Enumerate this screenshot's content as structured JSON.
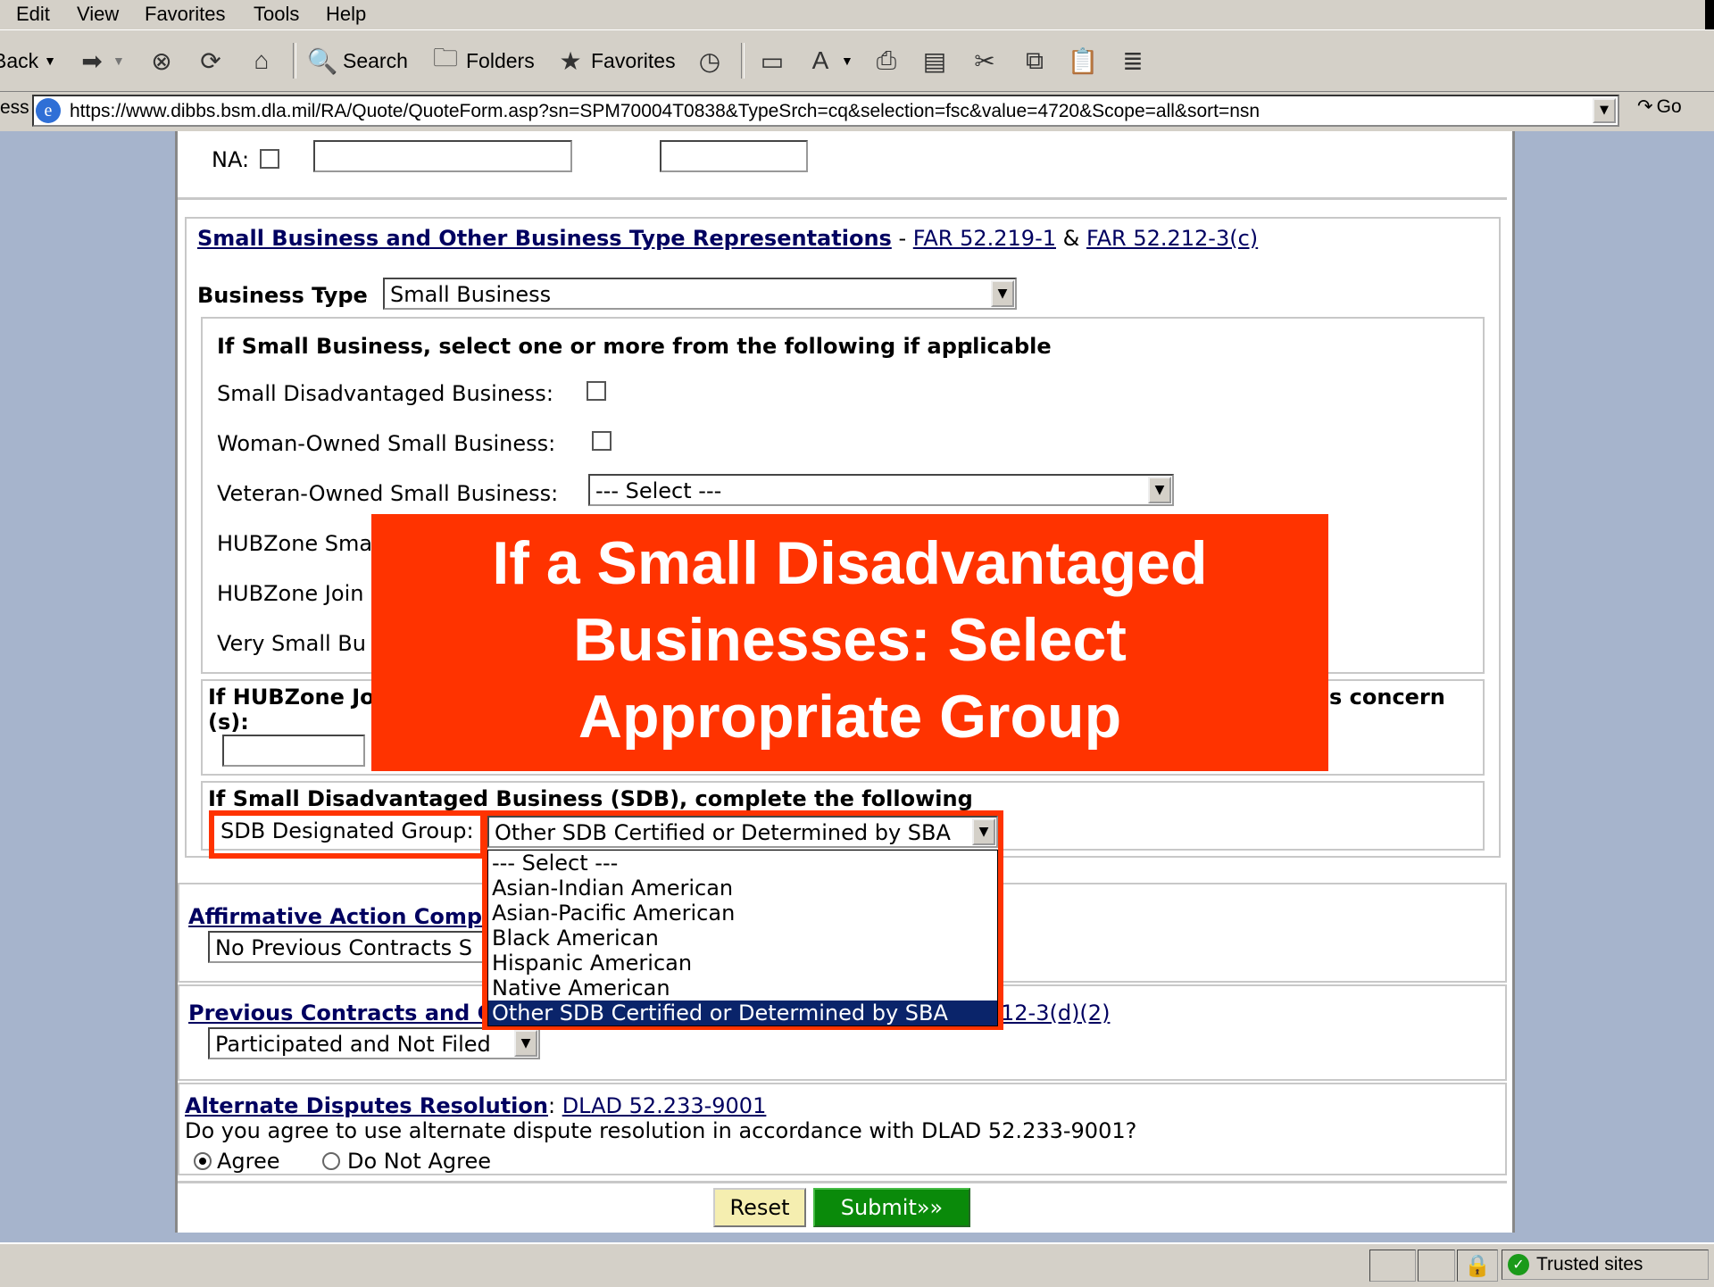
{
  "menu": [
    "Edit",
    "View",
    "Favorites",
    "Tools",
    "Help"
  ],
  "toolbar": {
    "back": "Back",
    "search": "Search",
    "folders": "Folders",
    "favorites": "Favorites"
  },
  "address": {
    "label": "ess",
    "url": "https://www.dibbs.bsm.dla.mil/RA/Quote/QuoteForm.asp?sn=SPM70004T0838&TypeSrch=cq&selection=fsc&value=4720&Scope=all&sort=nsn",
    "go": "Go"
  },
  "form": {
    "na_label": "NA:",
    "small_business_heading": "Small Business and Other Business Type Representations",
    "far_sep1": "-",
    "far_link1": "FAR 52.219-1",
    "far_sep2": "&",
    "far_link2": "FAR 52.212-3(c)",
    "business_type_label": "Business Type",
    "business_type_value": "Small Business",
    "if_small_heading": "If Small Business, select one or more from the following if applicable",
    "sdb_label": "Small Disadvantaged Business:",
    "wosb_label": "Woman-Owned Small Business:",
    "vosb_label": "Veteran-Owned Small Business:",
    "vosb_value": "--- Select ---",
    "hubzone_small_label": "HUBZone Sma",
    "hubzone_joint_label": "HUBZone Join",
    "very_small_label": "Very Small Bu",
    "hubzone_jv_heading_a": "If HUBZone Jo",
    "hubzone_jv_heading_b": "(s):",
    "hubzone_jv_heading_end": "s concern",
    "if_sdb_heading": "If Small Disadvantaged Business (SDB), complete the following",
    "sdb_group_label": "SDB Designated Group:",
    "sdb_group_value": "Other SDB Certified or Determined by SBA",
    "sdb_group_options": [
      "--- Select ---",
      "Asian-Indian American",
      "Asian-Pacific American",
      "Black American",
      "Hispanic American",
      "Native American",
      "Other SDB Certified or Determined by SBA"
    ],
    "affirmative_heading": "Affirmative Action Compli",
    "affirmative_value": "No Previous Contracts S",
    "previous_heading": "Previous Contracts and C",
    "previous_link": "12-3(d)(2)",
    "previous_value": "Participated and Not Filed",
    "adr_heading": "Alternate Disputes Resolution",
    "adr_link": "DLAD 52.233-9001",
    "adr_question": "Do you agree to use alternate dispute resolution in accordance with DLAD 52.233-9001?",
    "agree_label": "Agree",
    "disagree_label": "Do Not Agree",
    "reset_label": "Reset",
    "submit_label": "Submit»»"
  },
  "callout": {
    "line1": "If a Small Disadvantaged",
    "line2": "Businesses: Select",
    "line3": "Appropriate Group"
  },
  "status": {
    "zone": "Trusted sites"
  }
}
